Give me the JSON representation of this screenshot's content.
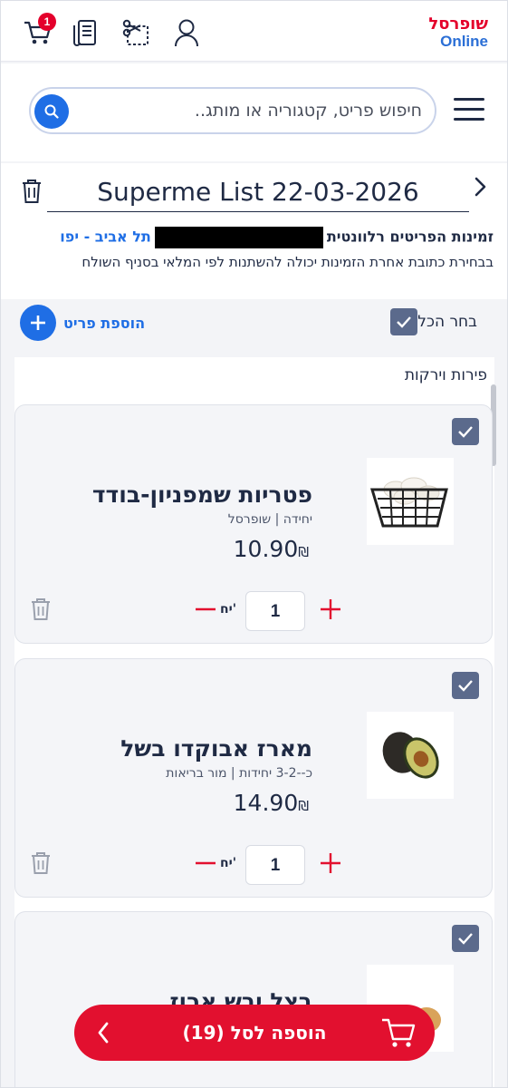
{
  "header": {
    "logo_line1": "שופרסל",
    "logo_line2": "Online",
    "cart_badge": "1",
    "icons": [
      "cart-icon",
      "receipt-icon",
      "coupon-icon",
      "user-icon"
    ]
  },
  "search": {
    "placeholder": "חיפוש פריט, קטגוריה או מותג.."
  },
  "list": {
    "title": "Superme List 22-03-2026",
    "availability_label": "זמינות הפריטים רלוונטית",
    "city": "תל אביב - יפו",
    "note": "בבחירת כתובת אחרת הזמינות יכולה להשתנות לפי המלאי בסניף השולח"
  },
  "actions": {
    "select_all": "בחר הכל",
    "add_item": "הוספת פריט"
  },
  "category": {
    "title": "פירות וירקות"
  },
  "products": [
    {
      "name": "פטריות שמפניון-בודד",
      "sub": "יחידה | שופרסל",
      "price": "10.90",
      "currency": "₪",
      "qty": "1",
      "unit": "יח'",
      "checked": true
    },
    {
      "name": "מארז אבוקדו בשל",
      "sub": "כ--3-2 יחידות | מור בריאות",
      "price": "14.90",
      "currency": "₪",
      "qty": "1",
      "unit": "יח'",
      "checked": true
    },
    {
      "name": "בצל יבש ארוז",
      "checked": true
    }
  ],
  "cart_bar": {
    "label": "הוספה לסל (19)"
  },
  "colors": {
    "brand_red": "#e2102f",
    "brand_blue": "#1f6ee5",
    "text_dark": "#1f2a44",
    "checkbox": "#5b6a8c"
  }
}
